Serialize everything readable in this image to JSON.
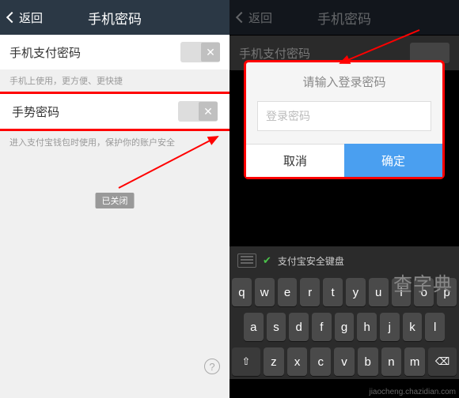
{
  "header": {
    "back": "返回",
    "title": "手机密码"
  },
  "rows": {
    "payment": {
      "label": "手机支付密码",
      "desc": "手机上使用，更方便、更快捷"
    },
    "gesture": {
      "label": "手势密码",
      "desc": "进入支付宝钱包时使用，保护你的账户安全"
    }
  },
  "closed_badge": "已关闭",
  "dialog": {
    "title": "请输入登录密码",
    "placeholder": "登录密码",
    "cancel": "取消",
    "confirm": "确定"
  },
  "keyboard": {
    "header": "支付宝安全键盘",
    "row1": [
      "q",
      "w",
      "e",
      "r",
      "t",
      "y",
      "u",
      "i",
      "o",
      "p"
    ],
    "row2": [
      "a",
      "s",
      "d",
      "f",
      "g",
      "h",
      "j",
      "k",
      "l"
    ],
    "row3": [
      "z",
      "x",
      "c",
      "v",
      "b",
      "n",
      "m"
    ],
    "shift": "⇧",
    "backspace": "⌫"
  },
  "watermark": {
    "big": "查字典",
    "small": "jiaocheng.chazidian.com"
  }
}
